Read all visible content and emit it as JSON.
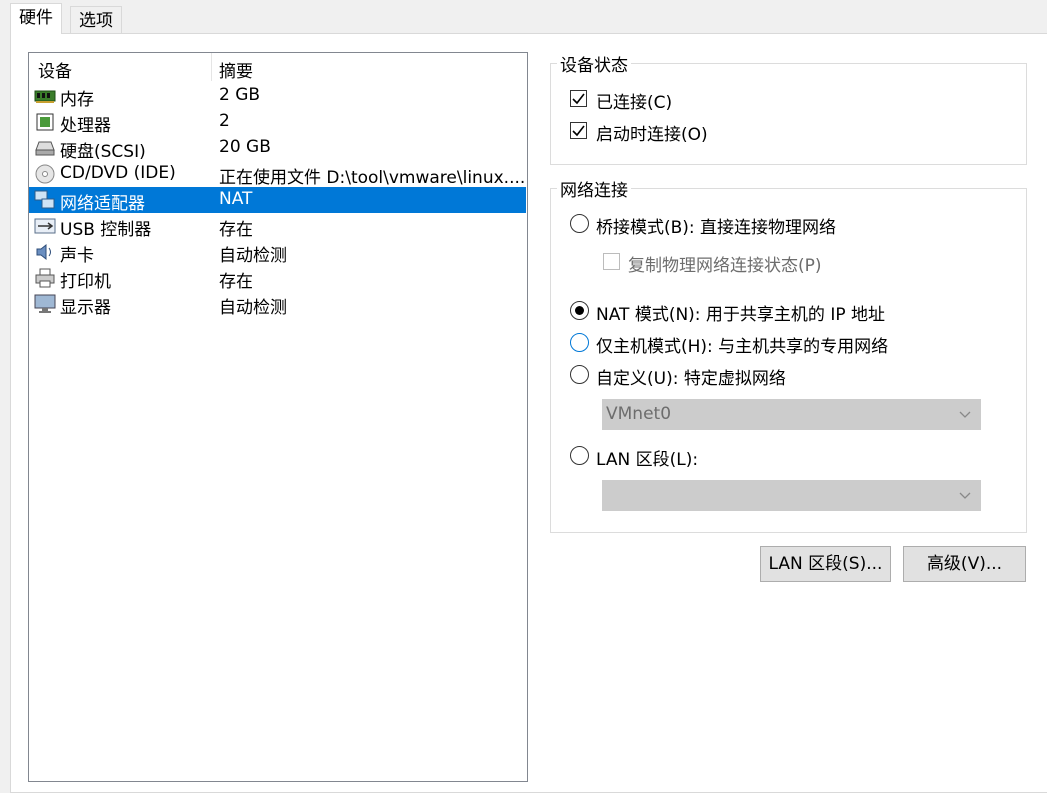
{
  "tabs": [
    {
      "label": "硬件"
    },
    {
      "label": "选项"
    }
  ],
  "device_list": {
    "headers": {
      "device": "设备",
      "summary": "摘要"
    },
    "rows": [
      {
        "name": "内存",
        "summary": "2 GB",
        "icon": "memory-icon"
      },
      {
        "name": "处理器",
        "summary": "2",
        "icon": "processor-icon"
      },
      {
        "name": "硬盘(SCSI)",
        "summary": "20 GB",
        "icon": "hard-disk-icon"
      },
      {
        "name": "CD/DVD (IDE)",
        "summary": "正在使用文件 D:\\tool\\vmware\\linux....",
        "icon": "cd-dvd-icon"
      },
      {
        "name": "网络适配器",
        "summary": "NAT",
        "icon": "network-adapter-icon",
        "selected": true
      },
      {
        "name": "USB 控制器",
        "summary": "存在",
        "icon": "usb-icon"
      },
      {
        "name": "声卡",
        "summary": "自动检测",
        "icon": "sound-card-icon"
      },
      {
        "name": "打印机",
        "summary": "存在",
        "icon": "printer-icon"
      },
      {
        "name": "显示器",
        "summary": "自动检测",
        "icon": "display-icon"
      }
    ]
  },
  "device_status": {
    "title": "设备状态",
    "connected": {
      "label": "已连接(C)",
      "checked": true
    },
    "connect_at_power_on": {
      "label": "启动时连接(O)",
      "checked": true
    }
  },
  "network_connection": {
    "title": "网络连接",
    "bridged": {
      "label": "桥接模式(B): 直接连接物理网络",
      "selected": false
    },
    "replicate": {
      "label": "复制物理网络连接状态(P)",
      "checked": false,
      "enabled": false
    },
    "nat": {
      "label": "NAT 模式(N): 用于共享主机的 IP 地址",
      "selected": true
    },
    "host_only": {
      "label": "仅主机模式(H): 与主机共享的专用网络",
      "selected": false
    },
    "custom": {
      "label": "自定义(U): 特定虚拟网络",
      "selected": false
    },
    "custom_select": {
      "value": "VMnet0"
    },
    "lan_segment": {
      "label": "LAN 区段(L):",
      "selected": false
    },
    "lan_select": {
      "value": ""
    }
  },
  "buttons": {
    "lan_segments": "LAN 区段(S)...",
    "advanced": "高级(V)..."
  },
  "colors": {
    "selection": "#0078d7",
    "focus_ring": "#0078d7"
  }
}
